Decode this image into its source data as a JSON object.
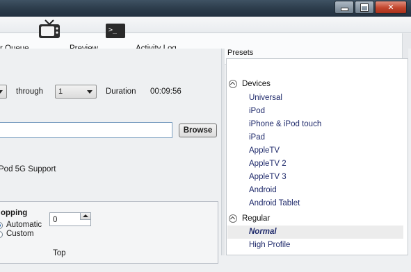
{
  "toolbar": {
    "queue_label": "r Queue",
    "preview_label": "Preview",
    "activity_log_label": "Activity Log",
    "terminal_prompt": ">_"
  },
  "range": {
    "start_value": "",
    "through_label": "through",
    "end_value": "1",
    "duration_label": "Duration",
    "duration_value": "00:09:56"
  },
  "destination": {
    "file_value": "",
    "browse_label": "Browse"
  },
  "options": {
    "ipod_support_label": "Pod 5G Support"
  },
  "cropping": {
    "title": "opping",
    "automatic_label": "Automatic",
    "custom_label": "Custom",
    "top_label": "Top",
    "top_value": "0"
  },
  "presets": {
    "title": "Presets",
    "groups": [
      {
        "name": "Devices",
        "items": [
          "Universal",
          "iPod",
          "iPhone & iPod touch",
          "iPad",
          "AppleTV",
          "AppleTV 2",
          "AppleTV 3",
          "Android",
          "Android Tablet"
        ]
      },
      {
        "name": "Regular",
        "items": [
          "Normal",
          "High Profile"
        ]
      }
    ],
    "selected": "Normal"
  }
}
